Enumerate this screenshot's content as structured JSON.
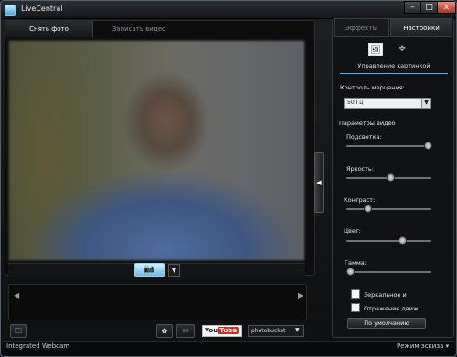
{
  "window": {
    "title": "LiveCentral",
    "min_glyph": "–",
    "max_glyph": "□",
    "close_glyph": "x"
  },
  "tabs": {
    "photo": "Снять фото",
    "video": "Записать видео"
  },
  "capture": {
    "camera_glyph": "📷",
    "dropdown_glyph": "▼"
  },
  "expand_glyph": "◀",
  "strip": {
    "prev": "◀",
    "next": "▶"
  },
  "bottom_bar": {
    "folder_glyph": "🗀",
    "effects_glyph": "✿",
    "mail_glyph": "✉",
    "youtube_you": "You",
    "youtube_tube": "Tube",
    "photobucket": "photobucket",
    "dropdown_glyph": "▼"
  },
  "status": {
    "left": "Integrated Webcam",
    "right": "Режим эскиза ▾"
  },
  "right_panel": {
    "tab_effects": "Эффекты",
    "tab_settings": "Настройки",
    "mode_image_glyph": "🖼",
    "mode_move_glyph": "✥",
    "subtab": "Управление картинкой",
    "flicker_label": "Контроль мерцания:",
    "flicker_value": "50 Гц",
    "flicker_arrow": "▼",
    "video_params_label": "Параметры видео",
    "defaults_button": "По умолчанию"
  },
  "sliders": [
    {
      "label": "Подсветка:",
      "value": 0.97
    },
    {
      "label": "Яркость:",
      "value": 0.5
    },
    {
      "label": "Контраст:",
      "value": 0.22
    },
    {
      "label": "Цвет:",
      "value": 0.65
    },
    {
      "label": "Гамма:",
      "value": 0.0
    }
  ],
  "checkboxes": [
    {
      "label": "Зеркальное и",
      "checked": false
    },
    {
      "label": "Отражение движ",
      "checked": false
    }
  ]
}
